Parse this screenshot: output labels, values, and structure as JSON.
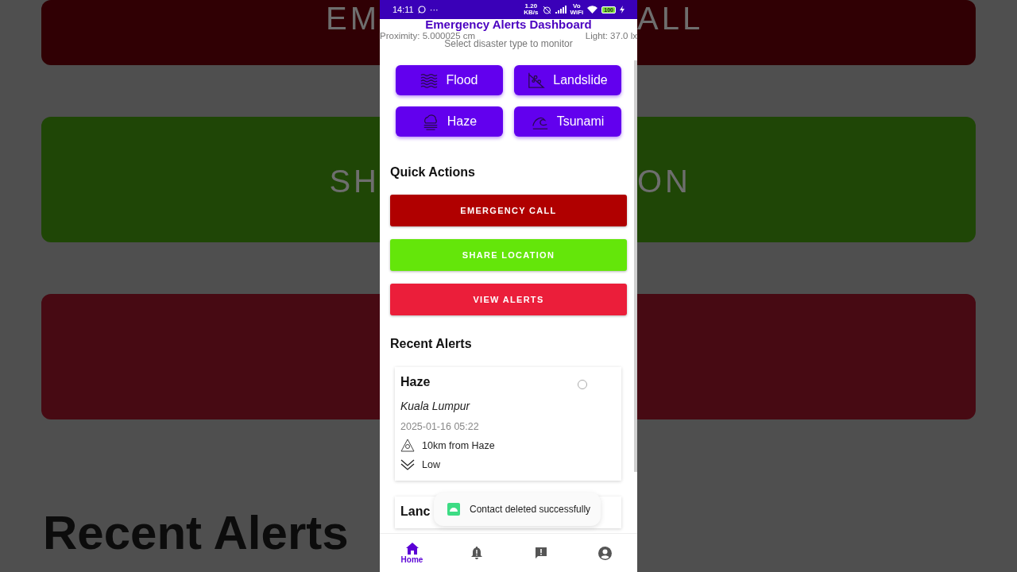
{
  "backdrop": {
    "left": {
      "bars": [
        {
          "color": "#300004",
          "text": "EM"
        },
        {
          "color": "#1f4606",
          "text": "SH"
        },
        {
          "color": "#470a13"
        }
      ],
      "heading": "Recent Alerts"
    },
    "right": {
      "bars": [
        {
          "color": "#300004",
          "text": "ALL"
        },
        {
          "color": "#1f4606",
          "text": "ON"
        },
        {
          "color": "#470a13"
        }
      ]
    }
  },
  "status_bar": {
    "time": "14:11",
    "more": "···",
    "net_speed": "1.20",
    "net_unit": "KB/s",
    "volte": "Vo",
    "wifi_label": "WiFi",
    "battery": "100"
  },
  "header": {
    "title": "Emergency Alerts Dashboard",
    "proximity": "Proximity: 5.000025 cm",
    "light": "Light: 37.0 lx",
    "subtitle": "Select disaster type to monitor"
  },
  "disaster_types": [
    {
      "kind": "flood",
      "label": "Flood"
    },
    {
      "kind": "landslide",
      "label": "Landslide"
    },
    {
      "kind": "haze",
      "label": "Haze"
    },
    {
      "kind": "tsunami",
      "label": "Tsunami"
    }
  ],
  "quick_actions": {
    "title": "Quick Actions",
    "buttons": [
      {
        "label": "EMERGENCY CALL",
        "color": "#b00000"
      },
      {
        "label": "SHARE LOCATION",
        "color": "#64e60a"
      },
      {
        "label": "VIEW ALERTS",
        "color": "#eb1e3a"
      }
    ]
  },
  "recent_alerts": {
    "title": "Recent Alerts",
    "alerts": [
      {
        "title": "Haze",
        "selected": false,
        "location": "Kuala Lumpur",
        "time": "2025-01-16 05:22",
        "distance": "10km from Haze",
        "severity": "Low"
      },
      {
        "title": "Lanc"
      }
    ]
  },
  "toast": {
    "text": "Contact deleted successfully"
  },
  "bottom_nav": [
    {
      "kind": "home",
      "label": "Home",
      "selected": true
    },
    {
      "kind": "alerts",
      "selected": false
    },
    {
      "kind": "report",
      "selected": false
    },
    {
      "kind": "profile",
      "selected": false
    }
  ]
}
